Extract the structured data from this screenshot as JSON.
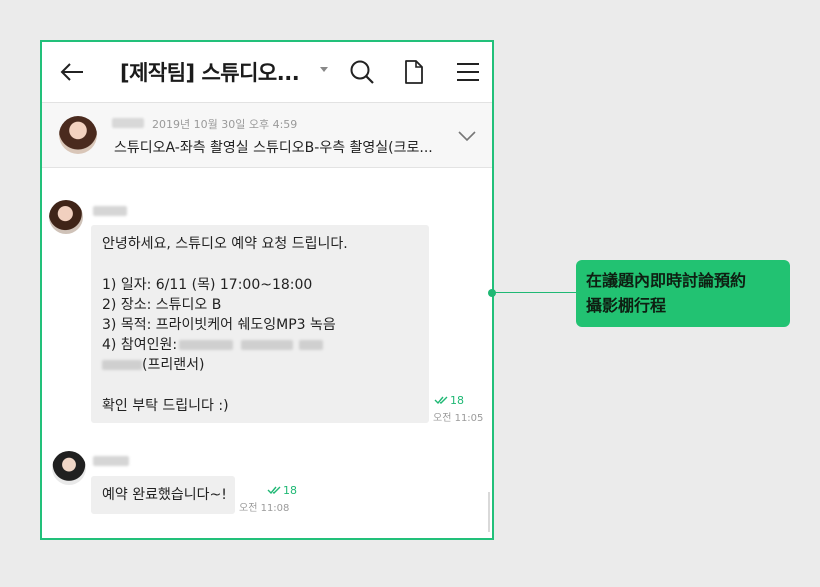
{
  "header": {
    "title": "[제작팀] 스튜디오...",
    "icons": {
      "back": "arrow-left-icon",
      "title_menu": "caret-down-icon",
      "search": "search-icon",
      "files": "document-icon",
      "menu": "hamburger-icon"
    }
  },
  "notice": {
    "timestamp": "2019년 10월 30일 오후 4:59",
    "text": "스튜디오A-좌측 촬영실  스튜디오B-우측 촬영실(크로...",
    "expand_icon": "chevron-down-icon"
  },
  "messages": [
    {
      "lines": [
        "안녕하세요, 스튜디오 예약 요청 드립니다.",
        "",
        "1) 일자: 6/11 (목) 17:00~18:00",
        "2) 장소: 스튜디오 B",
        "3) 목적: 프라이빗케어 쉐도잉MP3 녹음",
        "4) 참여인원:",
        "(프리랜서)",
        "",
        "확인 부탁 드립니다 :)"
      ],
      "read_count": "18",
      "time": "오전 11:05"
    },
    {
      "lines": [
        "예약 완료했습니다~!"
      ],
      "read_count": "18",
      "time": "오전 11:08"
    }
  ],
  "callout": {
    "line1": "在議題內即時討論預約",
    "line2": "攝影棚行程"
  },
  "colors": {
    "accent": "#22c272",
    "frame": "#22c07a",
    "bubble": "#efefef",
    "background": "#ebebeb"
  }
}
